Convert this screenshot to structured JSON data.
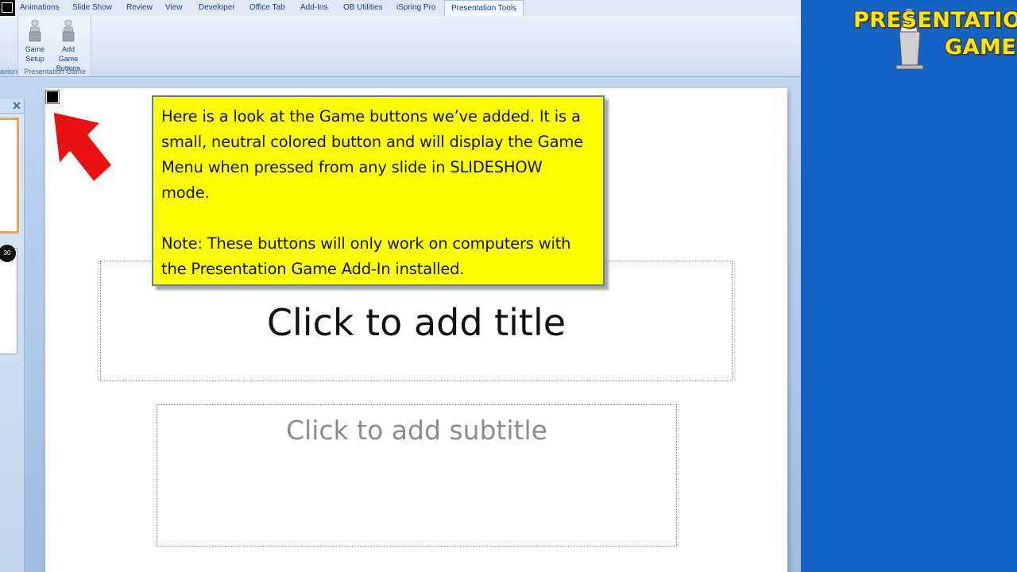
{
  "tabs": [
    {
      "label": "Animations"
    },
    {
      "label": "Slide Show"
    },
    {
      "label": "Review"
    },
    {
      "label": "View"
    },
    {
      "label": "Developer"
    },
    {
      "label": "Office Tab"
    },
    {
      "label": "Add-Ins"
    },
    {
      "label": "OB Utilities"
    },
    {
      "label": "iSpring Pro"
    },
    {
      "label": "Presentation Tools"
    }
  ],
  "ribbon": {
    "left_group_label": "anion",
    "group_label": "Presentation Game",
    "buttons": [
      {
        "label_line1": "Game",
        "label_line2": "Setup",
        "icon": "presenter-icon"
      },
      {
        "label_line1": "Add Game",
        "label_line2": "Buttons",
        "icon": "presenter-icon"
      }
    ]
  },
  "panel": {
    "close_glyph": "✕",
    "slide_number": "30"
  },
  "slide": {
    "title_placeholder": "Click to add title",
    "subtitle_placeholder": "Click to add subtitle"
  },
  "callout": {
    "paragraph1": "Here is a look at the Game buttons we’ve added. It is a small, neutral colored button and will display the Game Menu when pressed from any slide in SLIDESHOW mode.",
    "paragraph2": "Note: These buttons will only work on computers with the Presentation Game Add-In installed."
  },
  "brand": {
    "line1": "PRESENTATION",
    "line2": "GAME"
  },
  "colors": {
    "callout_bg": "#ffff00",
    "arrow": "#e81010",
    "brand_bg": "#1463c6",
    "logo_text": "#ffe600"
  }
}
